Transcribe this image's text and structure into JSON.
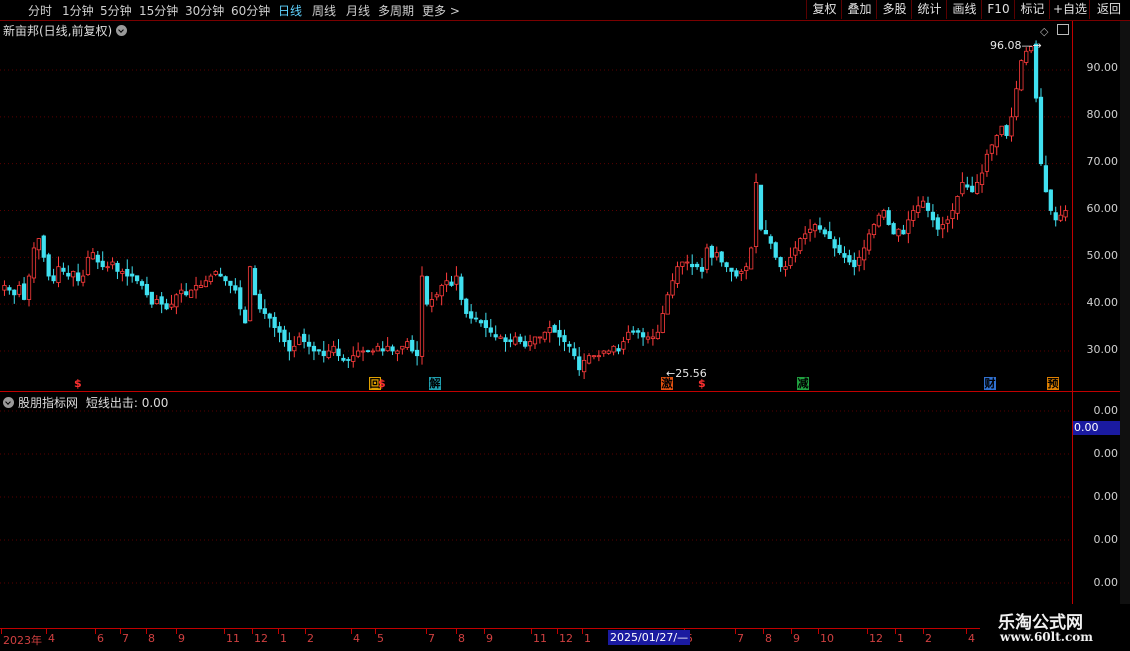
{
  "toolbar": {
    "periods": [
      "分时",
      "1分钟",
      "5分钟",
      "15分钟",
      "30分钟",
      "60分钟",
      "日线",
      "周线",
      "月线",
      "多周期",
      "更多 >"
    ],
    "active_period": "日线",
    "buttons": [
      "复权",
      "叠加",
      "多股",
      "统计",
      "画线",
      "F10",
      "标记",
      "+自选",
      "返回"
    ]
  },
  "main_chart": {
    "title": "新亩邦(日线,前复权)",
    "y_labels": [
      "90.00",
      "80.00",
      "70.00",
      "60.00",
      "50.00",
      "40.00",
      "30.00"
    ],
    "high_label": "96.08",
    "low_label": "25.56",
    "markers": [
      {
        "text": "$",
        "kind": "dollar"
      },
      {
        "text": "回",
        "kind": "box",
        "color": "#e0a000"
      },
      {
        "text": "$",
        "kind": "dollar"
      },
      {
        "text": "解",
        "kind": "box",
        "color": "#20a0b0"
      },
      {
        "text": "激",
        "kind": "box",
        "color": "#e05010"
      },
      {
        "text": "$",
        "kind": "dollar"
      },
      {
        "text": "减",
        "kind": "box",
        "color": "#20a040"
      },
      {
        "text": "财",
        "kind": "box",
        "color": "#3070d0"
      },
      {
        "text": "预",
        "kind": "box",
        "color": "#e08000"
      }
    ]
  },
  "sub_chart": {
    "title": "股朋指标网",
    "indicator_label": "短线出击: 0.00",
    "current_value": "0.00",
    "y_labels": [
      "0.00",
      "0.00",
      "0.00",
      "0.00",
      "0.00"
    ]
  },
  "date_axis": {
    "labels": [
      "2023年",
      "4",
      "6",
      "7",
      "8",
      "9",
      "11",
      "12",
      "1",
      "2",
      "4",
      "5",
      "7",
      "8",
      "9",
      "11",
      "12",
      "1",
      "5",
      "7",
      "8",
      "9",
      "10",
      "12",
      "1",
      "2",
      "4"
    ],
    "highlight": "2025/01/27/—"
  },
  "watermark": {
    "line1": "乐淘公式网",
    "line2": "www.60lt.com"
  },
  "chart_data": {
    "type": "candlestick",
    "title": "新亩邦(日线,前复权)",
    "ylim": [
      25,
      97
    ],
    "y_ticks": [
      30,
      40,
      50,
      60,
      70,
      80,
      90
    ],
    "high": 96.08,
    "low": 25.56,
    "series_close": [
      44,
      43,
      42,
      44,
      41,
      46,
      52,
      54,
      50,
      46,
      45,
      48,
      47,
      46,
      47,
      45,
      46,
      50,
      51,
      49,
      48,
      48,
      49,
      47,
      47,
      46,
      46,
      45,
      44,
      42,
      40,
      41,
      40,
      39,
      40,
      42,
      43,
      42,
      43,
      44,
      44,
      45,
      46,
      47,
      46,
      45,
      44,
      43,
      39,
      36,
      48,
      42,
      39,
      38,
      37,
      35,
      34,
      32,
      30,
      31,
      33,
      32,
      31,
      30,
      30,
      29,
      30,
      31,
      29,
      28,
      28,
      29,
      30,
      30,
      30,
      30,
      31,
      30,
      31,
      30,
      30,
      31,
      32,
      30,
      29,
      46,
      40,
      41,
      42,
      44,
      45,
      44,
      46,
      41,
      38,
      37,
      37,
      36,
      35,
      34,
      33,
      33,
      32,
      32,
      33,
      32,
      31,
      32,
      33,
      33,
      34,
      35,
      34,
      33,
      32,
      31,
      29,
      26,
      28,
      29,
      29,
      29,
      30,
      30,
      31,
      30,
      32,
      34,
      34,
      34,
      33,
      33,
      33,
      34,
      38,
      42,
      45,
      48,
      49,
      49,
      48,
      48,
      47,
      52,
      50,
      51,
      49,
      48,
      47,
      46,
      47,
      48,
      52,
      66,
      56,
      55,
      53,
      50,
      48,
      48,
      50,
      52,
      54,
      55,
      56,
      57,
      56,
      55,
      54,
      52,
      51,
      50,
      49,
      48,
      50,
      52,
      55,
      57,
      59,
      60,
      57,
      55,
      56,
      55,
      58,
      60,
      61,
      62,
      60,
      58,
      56,
      57,
      58,
      60,
      63,
      66,
      65,
      64,
      66,
      68,
      72,
      74,
      76,
      78,
      76,
      80,
      86,
      92,
      94,
      95,
      84,
      70,
      64,
      60,
      58,
      59,
      60
    ]
  }
}
